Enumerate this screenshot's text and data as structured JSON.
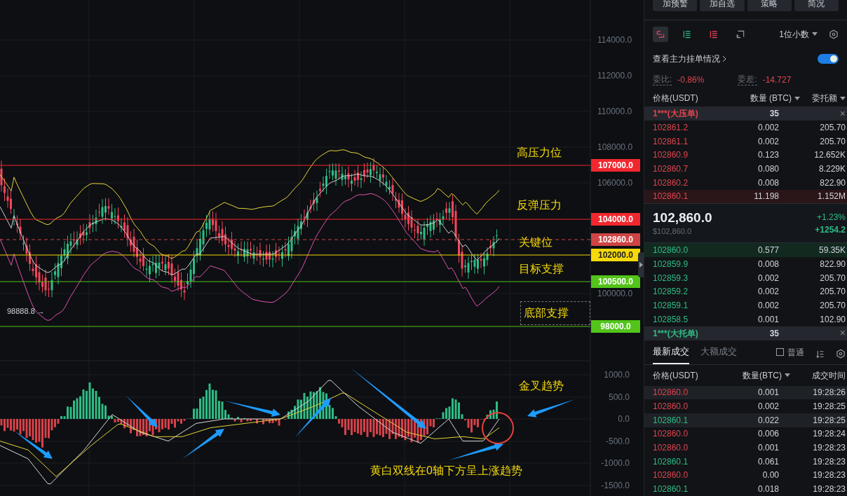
{
  "price_axis": {
    "ticks": [
      "114000.0",
      "112000.0",
      "110000.0",
      "108000.0",
      "106000.0",
      "100000.0"
    ]
  },
  "levels": [
    {
      "label": "107000.0",
      "color": "#f0272f"
    },
    {
      "label": "104000.0",
      "color": "#f0272f"
    },
    {
      "label": "102860.0",
      "color": "#cf4444"
    },
    {
      "label": "102000.0",
      "color": "#f5d90a"
    },
    {
      "label": "100500.0",
      "color": "#52c41a"
    },
    {
      "label": "98000.0",
      "color": "#52c41a"
    }
  ],
  "annotations": [
    {
      "text": "高压力位",
      "boxed": false
    },
    {
      "text": "反弹压力",
      "boxed": false
    },
    {
      "text": "关键位",
      "boxed": false
    },
    {
      "text": "目标支撑",
      "boxed": false
    },
    {
      "text": "底部支撑",
      "boxed": true
    },
    {
      "text": "金叉趋势",
      "boxed": false
    },
    {
      "text": "黄白双线在0轴下方呈上涨趋势",
      "boxed": false
    }
  ],
  "low_marker": {
    "text": "98888.8",
    "arrow": "→"
  },
  "macd_axis": {
    "ticks": [
      "1000.0",
      "500.0",
      "0.0",
      "-500.0",
      "-1000.0",
      "-1500.0"
    ]
  },
  "panel": {
    "actions": [
      "加预警",
      "加自选",
      "策略",
      "简况"
    ],
    "views": [
      {
        "selected": true
      },
      {
        "selected": false
      },
      {
        "selected": false
      },
      {
        "selected": false
      }
    ],
    "precision": "1位小数",
    "main_orders": {
      "label": "查看主力挂单情况",
      "on": true
    },
    "ratio": {
      "label": "委比:",
      "value": "-0.86%"
    },
    "diff": {
      "label": "委差:",
      "value": "-14.727"
    },
    "book_columns": [
      "价格(USDT)",
      "数量 (BTC)",
      "委托额"
    ],
    "big_ask": {
      "label": "1***(大压单)",
      "qty": "35",
      "close": "×"
    },
    "asks": [
      {
        "price": "102861.2",
        "qty": "0.002",
        "amount": "205.70",
        "highlighted": false
      },
      {
        "price": "102861.1",
        "qty": "0.002",
        "amount": "205.70",
        "highlighted": false
      },
      {
        "price": "102860.9",
        "qty": "0.123",
        "amount": "12.652K",
        "highlighted": false
      },
      {
        "price": "102860.7",
        "qty": "0.080",
        "amount": "8.229K",
        "highlighted": false
      },
      {
        "price": "102860.2",
        "qty": "0.008",
        "amount": "822.90",
        "highlighted": false
      },
      {
        "price": "102860.1",
        "qty": "11.198",
        "amount": "1.152M",
        "highlighted": true
      }
    ],
    "last": {
      "price": "102,860.0",
      "usd": "$102,860.0",
      "change_pct": "+1.23%",
      "change": "+1254.2"
    },
    "bids": [
      {
        "price": "102860.0",
        "qty": "0.577",
        "amount": "59.35K",
        "highlighted": true
      },
      {
        "price": "102859.9",
        "qty": "0.008",
        "amount": "822.90",
        "highlighted": false
      },
      {
        "price": "102859.3",
        "qty": "0.002",
        "amount": "205.70",
        "highlighted": false
      },
      {
        "price": "102859.2",
        "qty": "0.002",
        "amount": "205.70",
        "highlighted": false
      },
      {
        "price": "102859.1",
        "qty": "0.002",
        "amount": "205.70",
        "highlighted": false
      },
      {
        "price": "102858.5",
        "qty": "0.001",
        "amount": "102.90",
        "highlighted": false
      }
    ],
    "big_bid": {
      "label": "1***(大托单)",
      "qty": "35",
      "close": "×"
    },
    "trade_tabs": [
      {
        "label": "最新成交",
        "selected": true
      },
      {
        "label": "大额成交",
        "selected": false
      }
    ],
    "normal_filter": {
      "label": "普通",
      "checked": false
    },
    "trade_columns": [
      "价格(USDT)",
      "数量(BTC)",
      "成交时间"
    ],
    "trades": [
      {
        "price": "102860.0",
        "qty": "0.001",
        "time": "19:28:26",
        "kind": "sell",
        "highlighted": true
      },
      {
        "price": "102860.0",
        "qty": "0.002",
        "time": "19:28:25",
        "kind": "sell",
        "highlighted": false
      },
      {
        "price": "102860.1",
        "qty": "0.022",
        "time": "19:28:25",
        "kind": "buy",
        "highlighted": true
      },
      {
        "price": "102860.0",
        "qty": "0.006",
        "time": "19:28:24",
        "kind": "sell",
        "highlighted": false
      },
      {
        "price": "102860.0",
        "qty": "0.001",
        "time": "19:28:23",
        "kind": "sell",
        "highlighted": false
      },
      {
        "price": "102860.1",
        "qty": "0.061",
        "time": "19:28:23",
        "kind": "buy",
        "highlighted": false
      },
      {
        "price": "102860.0",
        "qty": "0.00",
        "time": "19:28:23",
        "kind": "sell",
        "highlighted": false
      },
      {
        "price": "102860.1",
        "qty": "0.018",
        "time": "19:28:23",
        "kind": "buy",
        "highlighted": false
      }
    ]
  }
}
